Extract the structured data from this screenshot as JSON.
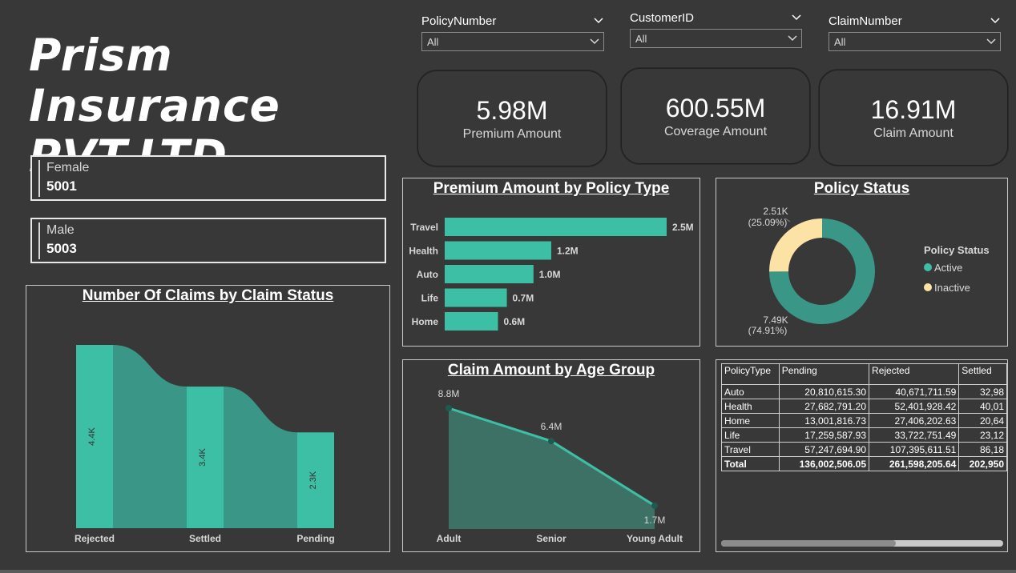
{
  "header": {
    "title_line1": "Prism Insurance",
    "title_line2": "PVT.LTD."
  },
  "gender_cards": [
    {
      "label": "Female",
      "value": "5001"
    },
    {
      "label": "Male",
      "value": "5003"
    }
  ],
  "slicers": [
    {
      "label": "PolicyNumber",
      "value": "All"
    },
    {
      "label": "CustomerID",
      "value": "All"
    },
    {
      "label": "ClaimNumber",
      "value": "All"
    }
  ],
  "kpis": [
    {
      "value": "5.98M",
      "label": "Premium Amount"
    },
    {
      "value": "600.55M",
      "label": "Coverage Amount"
    },
    {
      "value": "16.91M",
      "label": "Claim Amount"
    }
  ],
  "colors": {
    "teal": "#3dbfa5",
    "teal_dark": "#3a9787",
    "cream": "#fde2a6",
    "background": "#383838"
  },
  "claims_chart": {
    "title": "Number Of Claims by Claim Status",
    "chart_data": {
      "type": "ribbon-bar",
      "categories": [
        "Rejected",
        "Settled",
        "Pending"
      ],
      "values": [
        4400,
        3400,
        2300
      ],
      "value_labels": [
        "4.4K",
        "3.4K",
        "2.3K"
      ],
      "ylim": [
        0,
        4400
      ]
    }
  },
  "premium_chart": {
    "title": "Premium Amount by Policy Type",
    "chart_data": {
      "type": "bar",
      "orientation": "horizontal",
      "categories": [
        "Travel",
        "Health",
        "Auto",
        "Life",
        "Home"
      ],
      "values": [
        2.5,
        1.2,
        1.0,
        0.7,
        0.6
      ],
      "value_labels": [
        "2.5M",
        "1.2M",
        "1.0M",
        "0.7M",
        "0.6M"
      ],
      "unit": "M"
    }
  },
  "status_chart": {
    "title": "Policy Status",
    "legend_title": "Policy Status",
    "chart_data": {
      "type": "pie",
      "donut": true,
      "categories": [
        "Active",
        "Inactive"
      ],
      "values": [
        7.49,
        2.51
      ],
      "percent": [
        74.91,
        25.09
      ],
      "value_labels": [
        "7.49K",
        "2.51K"
      ],
      "percent_labels": [
        "(74.91%)",
        "(25.09%)"
      ],
      "legend_position": "right"
    }
  },
  "age_chart": {
    "title": "Claim Amount by Age Group",
    "chart_data": {
      "type": "area",
      "categories": [
        "Adult",
        "Senior",
        "Young Adult"
      ],
      "values": [
        8.8,
        6.4,
        1.7
      ],
      "value_labels": [
        "8.8M",
        "6.4M",
        "1.7M"
      ],
      "ylim": [
        0,
        8.8
      ]
    }
  },
  "matrix": {
    "columns": [
      "PolicyType",
      "Pending",
      "Rejected",
      "Settled"
    ],
    "rows": [
      [
        "Auto",
        "20,810,615.30",
        "40,671,711.59",
        "32,98"
      ],
      [
        "Health",
        "27,682,791.20",
        "52,401,928.42",
        "40,01"
      ],
      [
        "Home",
        "13,001,816.73",
        "27,406,202.63",
        "20,64"
      ],
      [
        "Life",
        "17,259,587.93",
        "33,722,751.49",
        "23,12"
      ],
      [
        "Travel",
        "57,247,694.90",
        "107,395,611.51",
        "86,18"
      ],
      [
        "Total",
        "136,002,506.05",
        "261,598,205.64",
        "202,950"
      ]
    ]
  }
}
